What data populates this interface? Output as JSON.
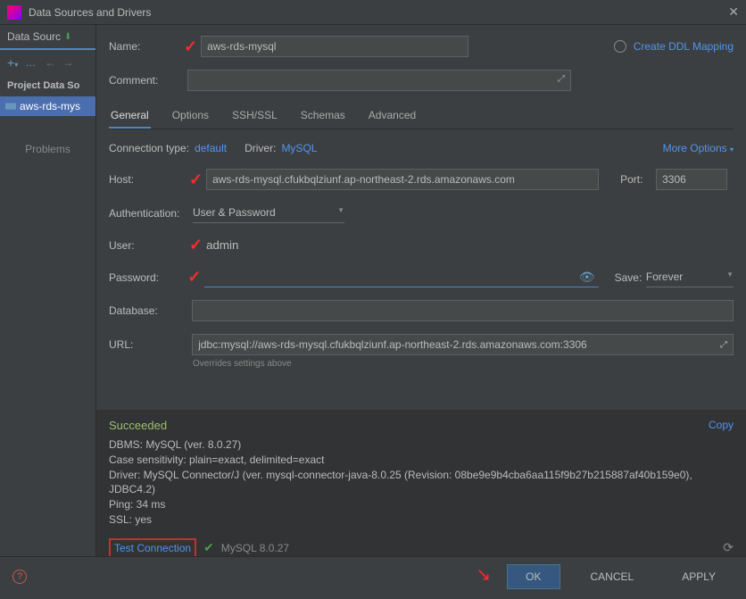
{
  "titlebar": {
    "title": "Data Sources and Drivers"
  },
  "sidebar": {
    "tab": "Data Sourc",
    "section": "Project Data So",
    "item": "aws-rds-mys",
    "problems": "Problems"
  },
  "form": {
    "name_label": "Name:",
    "name": "aws-rds-mysql",
    "comment_label": "Comment:",
    "ddl_link": "Create DDL Mapping"
  },
  "tabs": {
    "general": "General",
    "options": "Options",
    "sshssl": "SSH/SSL",
    "schemas": "Schemas",
    "advanced": "Advanced"
  },
  "conn": {
    "ct_label": "Connection type:",
    "ct_value": "default",
    "drv_label": "Driver:",
    "drv_value": "MySQL",
    "more": "More Options"
  },
  "host": {
    "label": "Host:",
    "value": "aws-rds-mysql.cfukbqlziunf.ap-northeast-2.rds.amazonaws.com",
    "port_label": "Port:",
    "port": "3306"
  },
  "auth": {
    "label": "Authentication:",
    "value": "User & Password"
  },
  "user": {
    "label": "User:",
    "value": "admin"
  },
  "pwd": {
    "label": "Password:",
    "save_label": "Save:",
    "save_value": "Forever"
  },
  "database": {
    "label": "Database:"
  },
  "url": {
    "label": "URL:",
    "value": "jdbc:mysql://aws-rds-mysql.cfukbqlziunf.ap-northeast-2.rds.amazonaws.com:3306",
    "note": "Overrides settings above"
  },
  "result": {
    "status": "Succeeded",
    "copy": "Copy",
    "l1": "DBMS: MySQL (ver. 8.0.27)",
    "l2": "Case sensitivity: plain=exact, delimited=exact",
    "l3": "Driver: MySQL Connector/J (ver. mysql-connector-java-8.0.25 (Revision: 08be9e9b4cba6aa115f9b27b215887af40b159e0), JDBC4.2)",
    "l4": "Ping: 34 ms",
    "l5": "SSL: yes",
    "test": "Test Connection",
    "version": "MySQL 8.0.27"
  },
  "footer": {
    "ok": "OK",
    "cancel": "CANCEL",
    "apply": "APPLY"
  }
}
